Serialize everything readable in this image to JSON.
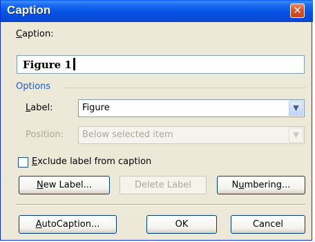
{
  "window": {
    "title": "Caption",
    "close_icon": "close-icon"
  },
  "caption": {
    "label": "Caption:",
    "value": "Figure 1"
  },
  "options": {
    "title": "Options",
    "label_field": {
      "label": "Label:",
      "selected": "Figure"
    },
    "position_field": {
      "label": "Position:",
      "selected": "Below selected item",
      "enabled": false
    }
  },
  "exclude_checkbox": {
    "label": "Exclude label from caption",
    "checked": false
  },
  "buttons": {
    "new_label": "New Label...",
    "delete_label": "Delete Label",
    "numbering": "Numbering...",
    "autocaption": "AutoCaption...",
    "ok": "OK",
    "cancel": "Cancel"
  },
  "colors": {
    "titlebar": "#0553e4",
    "dialog_bg": "#ece9d8",
    "close_button": "#d9532e",
    "group_title": "#1c5cd6"
  }
}
